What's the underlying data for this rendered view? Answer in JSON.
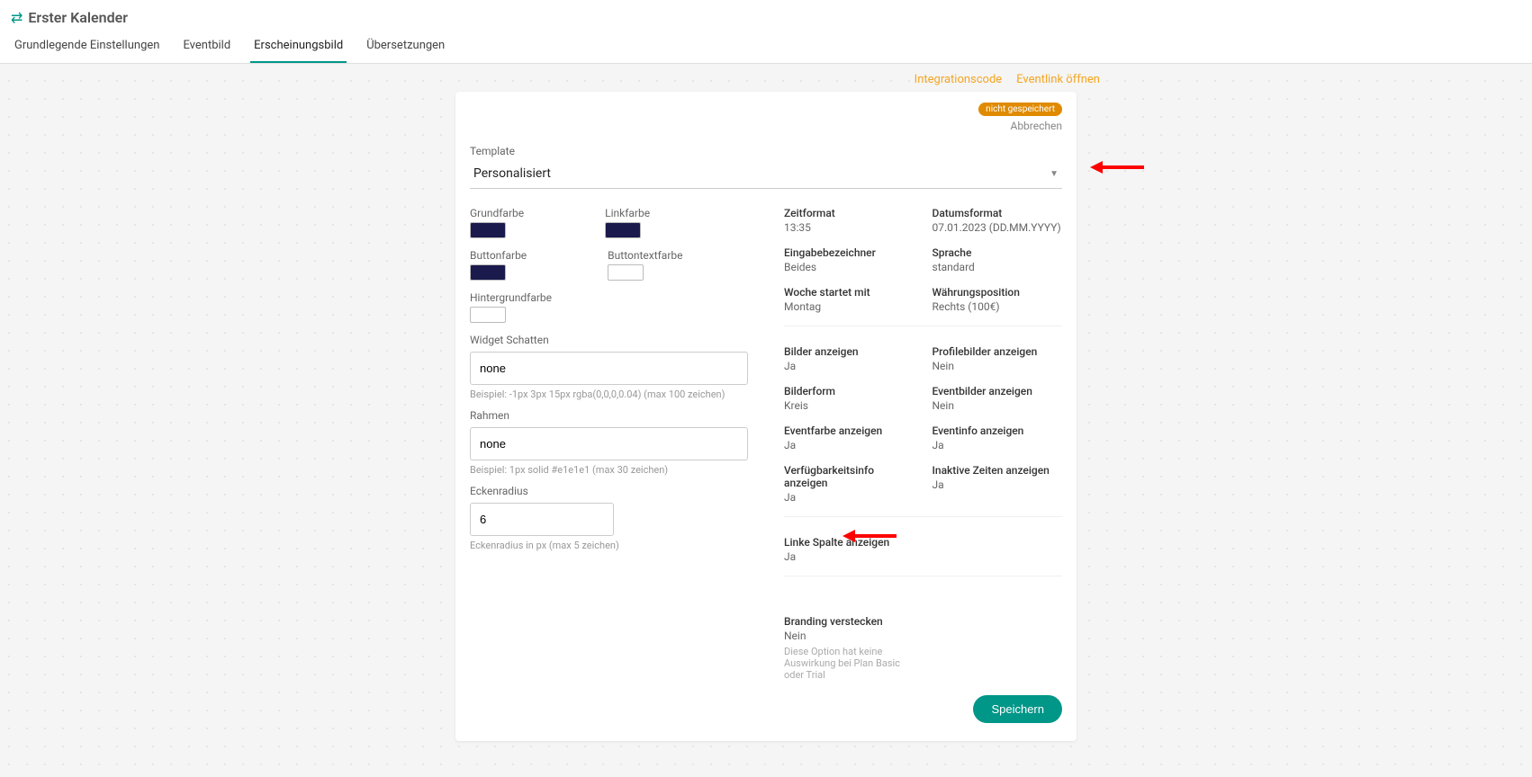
{
  "header": {
    "title": "Erster Kalender"
  },
  "tabs": {
    "basic": "Grundlegende Einstellungen",
    "image": "Eventbild",
    "appearance": "Erscheinungsbild",
    "translations": "Übersetzungen"
  },
  "topLinks": {
    "integration": "Integrationscode",
    "eventlink": "Eventlink öffnen"
  },
  "card": {
    "unsaved": "nicht gespeichert",
    "cancel": "Abbrechen",
    "templateLabel": "Template",
    "templateValue": "Personalisiert",
    "saveLabel": "Speichern"
  },
  "colors": {
    "primaryLabel": "Grundfarbe",
    "linkLabel": "Linkfarbe",
    "buttonLabel": "Buttonfarbe",
    "buttonTextLabel": "Buttontextfarbe",
    "backgroundLabel": "Hintergrundfarbe"
  },
  "inputs": {
    "shadowLabel": "Widget Schatten",
    "shadowValue": "none",
    "shadowHelper": "Beispiel: -1px 3px 15px rgba(0,0,0,0.04) (max 100 zeichen)",
    "borderLabel": "Rahmen",
    "borderValue": "none",
    "borderHelper": "Beispiel: 1px solid #e1e1e1 (max 30 zeichen)",
    "radiusLabel": "Eckenradius",
    "radiusValue": "6",
    "radiusHelper": "Eckenradius in px (max 5 zeichen)"
  },
  "settings": {
    "timeFormat": {
      "label": "Zeitformat",
      "value": "13:35"
    },
    "dateFormat": {
      "label": "Datumsformat",
      "value": "07.01.2023 (DD.MM.YYYY)"
    },
    "inputLabel": {
      "label": "Eingabebezeichner",
      "value": "Beides"
    },
    "language": {
      "label": "Sprache",
      "value": "standard"
    },
    "weekStart": {
      "label": "Woche startet mit",
      "value": "Montag"
    },
    "currencyPos": {
      "label": "Währungsposition",
      "value": "Rechts (100€)"
    },
    "showImages": {
      "label": "Bilder anzeigen",
      "value": "Ja"
    },
    "showProfileImages": {
      "label": "Profilebilder anzeigen",
      "value": "Nein"
    },
    "imageShape": {
      "label": "Bilderform",
      "value": "Kreis"
    },
    "showEventImages": {
      "label": "Eventbilder anzeigen",
      "value": "Nein"
    },
    "showEventColor": {
      "label": "Eventfarbe anzeigen",
      "value": "Ja"
    },
    "showEventInfo": {
      "label": "Eventinfo anzeigen",
      "value": "Ja"
    },
    "showAvailability": {
      "label": "Verfügbarkeitsinfo anzeigen",
      "value": "Ja"
    },
    "showInactive": {
      "label": "Inaktive Zeiten anzeigen",
      "value": "Ja"
    },
    "showLeftCol": {
      "label": "Linke Spalte anzeigen",
      "value": "Ja"
    },
    "hideBranding": {
      "label": "Branding verstecken",
      "value": "Nein",
      "note": "Diese Option hat keine Auswirkung bei Plan Basic oder Trial"
    }
  }
}
